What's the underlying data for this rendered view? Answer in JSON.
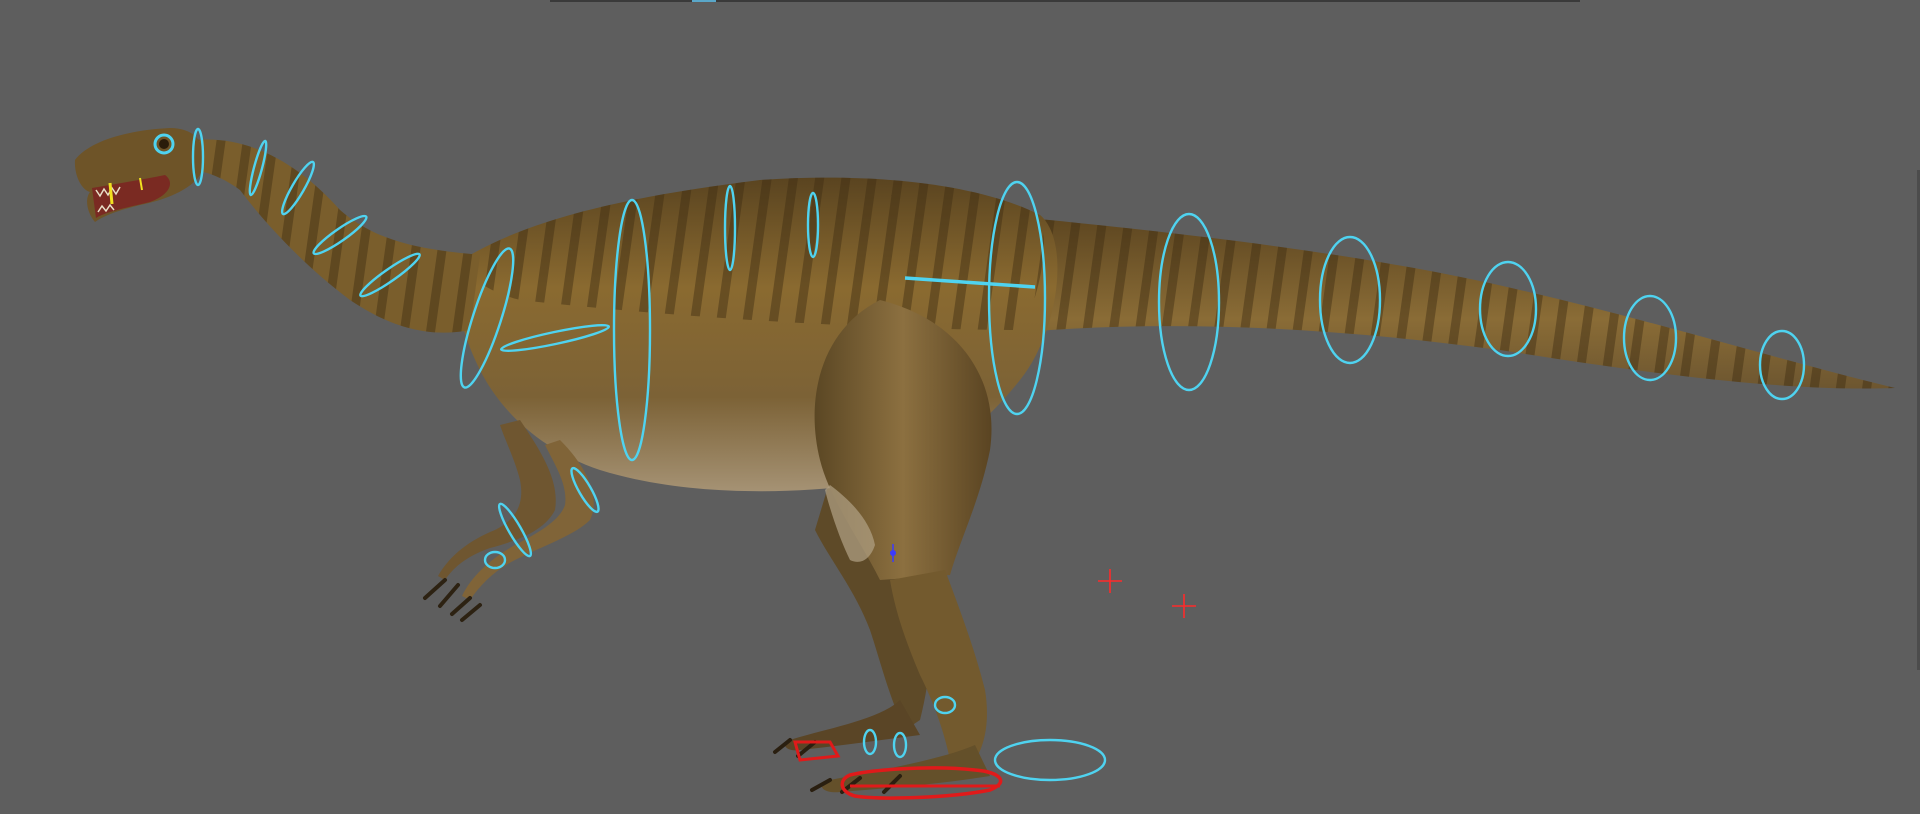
{
  "viewport": {
    "background_color": "#5e5e5e",
    "strip_color": "#3a3a3a",
    "strip_marker_color": "#5aa7c9"
  },
  "model": {
    "subject": "dinosaur-rig",
    "skin_base_color": "#7a5f2e",
    "skin_dark_color": "#3f2e14",
    "belly_color": "#9c8c70",
    "stripe_color": "#4a3416"
  },
  "rig": {
    "fk_control_color": "#4fd3f0",
    "ik_control_color": "#e01a1a",
    "locator_color": "#ff2a2a",
    "pole_vector_color": "#3a3aff"
  }
}
